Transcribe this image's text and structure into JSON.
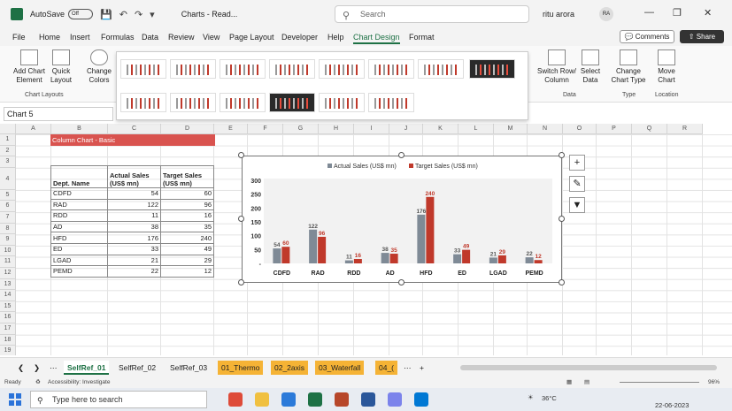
{
  "titlebar": {
    "autosave_label": "AutoSave",
    "autosave_state": "Off",
    "doc_title": "Charts - Read...",
    "search_placeholder": "Search",
    "user_name": "ritu arora",
    "user_initials": "RA"
  },
  "menu": [
    "File",
    "Home",
    "Insert",
    "Formulas",
    "Data",
    "Review",
    "View",
    "Page Layout",
    "Developer",
    "Help",
    "Chart Design",
    "Format"
  ],
  "menu_active": "Chart Design",
  "comments_label": "Comments",
  "share_label": "Share",
  "ribbon": {
    "add_chart_element": "Add Chart Element",
    "quick_layout": "Quick Layout",
    "change_colors": "Change Colors",
    "chart_layouts_label": "Chart Layouts",
    "switch_row_column": "Switch Row/ Column",
    "select_data": "Select Data",
    "data_group_label": "Data",
    "change_chart_type": "Change Chart Type",
    "type_group_label": "Type",
    "move_chart": "Move Chart",
    "location_group_label": "Location"
  },
  "namebox": "Chart 5",
  "columns": [
    "A",
    "B",
    "C",
    "D",
    "E",
    "F",
    "G",
    "H",
    "I",
    "J",
    "K",
    "L",
    "M",
    "N",
    "O",
    "P",
    "Q",
    "R"
  ],
  "rows": [
    "1",
    "2",
    "3",
    "4",
    "5",
    "6",
    "7",
    "8",
    "9",
    "10",
    "11",
    "12",
    "13",
    "14",
    "15",
    "16",
    "17",
    "18",
    "19",
    "20"
  ],
  "sheet_title_cell": "Column Chart - Basic",
  "table": {
    "headers": [
      "Dept. Name",
      "Actual Sales (US$ mn)",
      "Target Sales (US$ mn)"
    ],
    "rows": [
      [
        "CDFD",
        "54",
        "60"
      ],
      [
        "RAD",
        "122",
        "96"
      ],
      [
        "RDD",
        "11",
        "16"
      ],
      [
        "AD",
        "38",
        "35"
      ],
      [
        "HFD",
        "176",
        "240"
      ],
      [
        "ED",
        "33",
        "49"
      ],
      [
        "LGAD",
        "21",
        "29"
      ],
      [
        "PEMD",
        "22",
        "12"
      ]
    ]
  },
  "chart_data": {
    "type": "bar",
    "categories": [
      "CDFD",
      "RAD",
      "RDD",
      "AD",
      "HFD",
      "ED",
      "LGAD",
      "PEMD"
    ],
    "series": [
      {
        "name": "Actual Sales (US$ mn)",
        "values": [
          54,
          122,
          11,
          38,
          176,
          33,
          21,
          22
        ],
        "color": "#7f8a96"
      },
      {
        "name": "Target Sales (US$ mn)",
        "values": [
          60,
          96,
          16,
          35,
          240,
          49,
          29,
          12
        ],
        "color": "#c0392b"
      }
    ],
    "yticks": [
      "300",
      "250",
      "200",
      "150",
      "100",
      "50",
      "-"
    ],
    "ylim": [
      0,
      300
    ],
    "legend": "top",
    "grid": false
  },
  "sheet_tabs": [
    {
      "label": "SelfRef_01",
      "style": "active"
    },
    {
      "label": "SelfRef_02",
      "style": "normal"
    },
    {
      "label": "SelfRef_03",
      "style": "normal"
    },
    {
      "label": "01_Thermo",
      "style": "orange"
    },
    {
      "label": "02_2axis",
      "style": "orange"
    },
    {
      "label": "03_Waterfall",
      "style": "orange"
    },
    {
      "label": "04_(",
      "style": "orange"
    }
  ],
  "status": {
    "ready": "Ready",
    "accessibility": "Accessibility: Investigate",
    "zoom": "96%"
  },
  "taskbar": {
    "search_placeholder": "Type here to search",
    "temperature": "36°C",
    "date": "22-06-2023"
  },
  "colors": {
    "excel_green": "#1e7145",
    "title_cell_bg": "#d9534f",
    "orange_tab": "#f5b335"
  }
}
